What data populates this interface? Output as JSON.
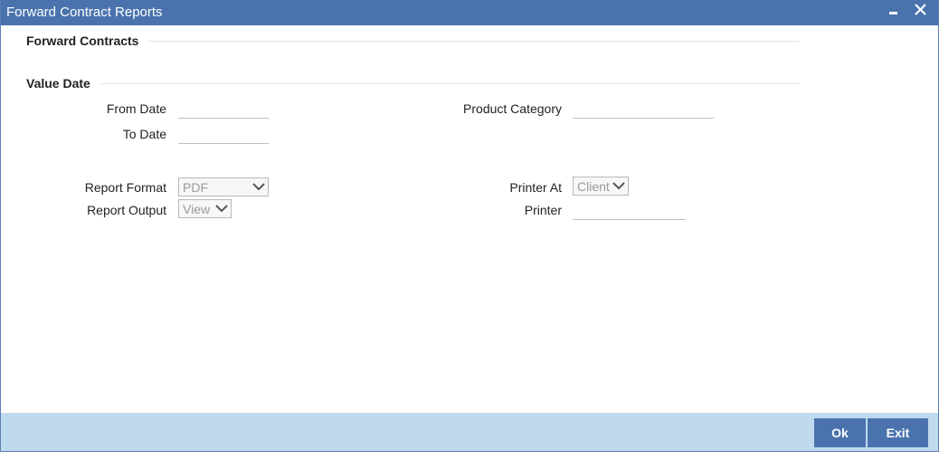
{
  "window": {
    "title": "Forward Contract Reports"
  },
  "sections": {
    "forward_contracts": "Forward Contracts",
    "value_date": "Value Date"
  },
  "fields": {
    "from_date": {
      "label": "From Date",
      "value": ""
    },
    "to_date": {
      "label": "To Date",
      "value": ""
    },
    "product_category": {
      "label": "Product Category",
      "value": ""
    },
    "report_format": {
      "label": "Report Format",
      "selected": "PDF"
    },
    "report_output": {
      "label": "Report Output",
      "selected": "View"
    },
    "printer_at": {
      "label": "Printer At",
      "selected": "Client"
    },
    "printer": {
      "label": "Printer",
      "value": ""
    }
  },
  "footer": {
    "ok_label": "Ok",
    "exit_label": "Exit"
  },
  "colors": {
    "titlebar": "#4a73ad",
    "footer": "#bfd9ef",
    "button": "#4a73ad"
  },
  "icons": {
    "minimize": "minimize-icon",
    "close": "close-icon",
    "dropdown": "chevron-down-icon"
  }
}
